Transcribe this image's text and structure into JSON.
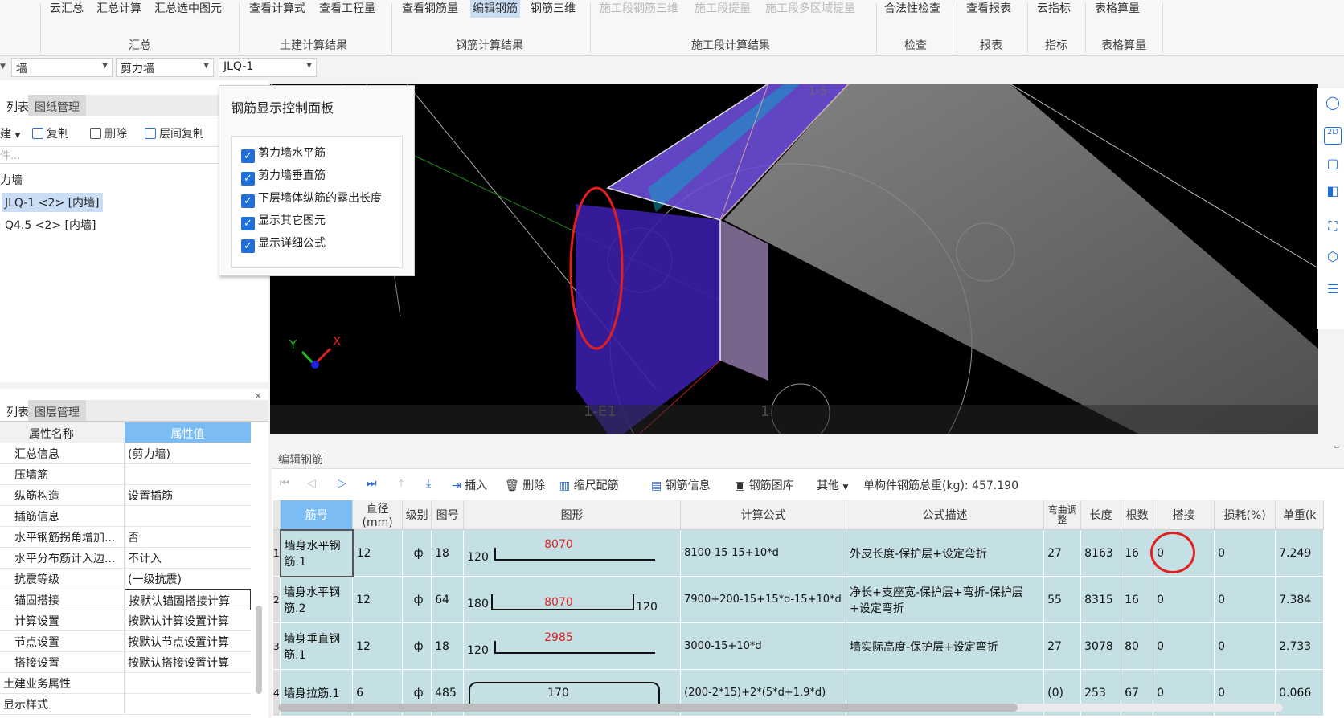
{
  "ribbon": {
    "buttons": [
      "云汇总",
      "汇总计算",
      "汇总选中图元",
      "查看计算式",
      "查看工程量",
      "查看钢筋量",
      "编辑钢筋",
      "钢筋三维",
      "施工段钢筋三维",
      "施工段提量",
      "施工段多区域提量",
      "合法性检查",
      "查看报表",
      "云指标",
      "表格算量"
    ],
    "groups": [
      "汇总",
      "土建计算结果",
      "钢筋计算结果",
      "施工段计算结果",
      "检查",
      "报表",
      "指标",
      "表格算量"
    ]
  },
  "selectors": {
    "type": "墙",
    "subtype": "剪力墙",
    "name": "JLQ-1"
  },
  "component_panel": {
    "tabs": [
      "列表",
      "图纸管理"
    ],
    "toolbar": [
      "建",
      "复制",
      "删除",
      "层间复制"
    ],
    "search_placeholder": "件...",
    "tree_root": "力墙",
    "items": [
      "JLQ-1 <2> [内墙]",
      "Q4.5 <2> [内墙]"
    ]
  },
  "property_panel": {
    "tabs": [
      "列表",
      "图层管理"
    ],
    "col_name": "属性名称",
    "col_value": "属性值",
    "rows": [
      {
        "name": "汇总信息",
        "value": "(剪力墙)"
      },
      {
        "name": "压墙筋",
        "value": ""
      },
      {
        "name": "纵筋构造",
        "value": "设置插筋"
      },
      {
        "name": "插筋信息",
        "value": ""
      },
      {
        "name": "水平钢筋拐角增加...",
        "value": "否"
      },
      {
        "name": "水平分布筋计入边...",
        "value": "不计入"
      },
      {
        "name": "抗震等级",
        "value": "(一级抗震)"
      },
      {
        "name": "锚固搭接",
        "value": "按默认锚固搭接计算"
      },
      {
        "name": "计算设置",
        "value": "按默认计算设置计算"
      },
      {
        "name": "节点设置",
        "value": "按默认节点设置计算"
      },
      {
        "name": "搭接设置",
        "value": "按默认搭接设置计算"
      },
      {
        "name": "土建业务属性",
        "value": ""
      },
      {
        "name": "显示样式",
        "value": ""
      }
    ]
  },
  "control_panel": {
    "title": "钢筋显示控制面板",
    "options": [
      "剪力墙水平筋",
      "剪力墙垂直筋",
      "下层墙体纵筋的露出长度",
      "显示其它图元",
      "显示详细公式"
    ]
  },
  "viewport": {
    "labels": [
      "1-E1",
      "1-5"
    ],
    "axis_x": "X",
    "axis_y": "Y"
  },
  "editor": {
    "title": "编辑钢筋",
    "toolbar": {
      "insert": "插入",
      "delete": "删除",
      "scale": "缩尺配筋",
      "info": "钢筋信息",
      "library": "钢筋图库",
      "other": "其他",
      "total": "单构件钢筋总重(kg): 457.190"
    },
    "columns": [
      "筋号",
      "直径(mm)",
      "级别",
      "图号",
      "图形",
      "计算公式",
      "公式描述",
      "弯曲调整",
      "长度",
      "根数",
      "搭接",
      "损耗(%)",
      "单重(k"
    ],
    "rows": [
      {
        "idx": "1",
        "name": "墙身水平钢筋.1",
        "dia": "12",
        "grade": "ф",
        "fig": "18",
        "left": "120",
        "mid": "8070",
        "right": "",
        "formula": "8100-15-15+10*d",
        "desc": "外皮长度-保护层+设定弯折",
        "bend": "27",
        "len": "8163",
        "count": "16",
        "lap": "0",
        "loss": "0",
        "unit": "7.249"
      },
      {
        "idx": "2",
        "name": "墙身水平钢筋.2",
        "dia": "12",
        "grade": "ф",
        "fig": "64",
        "left": "180",
        "mid": "8070",
        "right": "120",
        "formula": "7900+200-15+15*d-15+10*d",
        "desc": "净长+支座宽-保护层+弯折-保护层+设定弯折",
        "bend": "55",
        "len": "8315",
        "count": "16",
        "lap": "0",
        "loss": "0",
        "unit": "7.384"
      },
      {
        "idx": "3",
        "name": "墙身垂直钢筋.1",
        "dia": "12",
        "grade": "ф",
        "fig": "18",
        "left": "120",
        "mid": "2985",
        "right": "",
        "formula": "3000-15+10*d",
        "desc": "墙实际高度-保护层+设定弯折",
        "bend": "27",
        "len": "3078",
        "count": "80",
        "lap": "0",
        "loss": "0",
        "unit": "2.733"
      },
      {
        "idx": "4",
        "name": "墙身拉筋.1",
        "dia": "6",
        "grade": "ф",
        "fig": "485",
        "left": "",
        "mid": "170",
        "right": "",
        "formula": "(200-2*15)+2*(5*d+1.9*d)",
        "desc": "",
        "bend": "(0)",
        "len": "253",
        "count": "67",
        "lap": "0",
        "loss": "0",
        "unit": "0.066"
      }
    ]
  }
}
